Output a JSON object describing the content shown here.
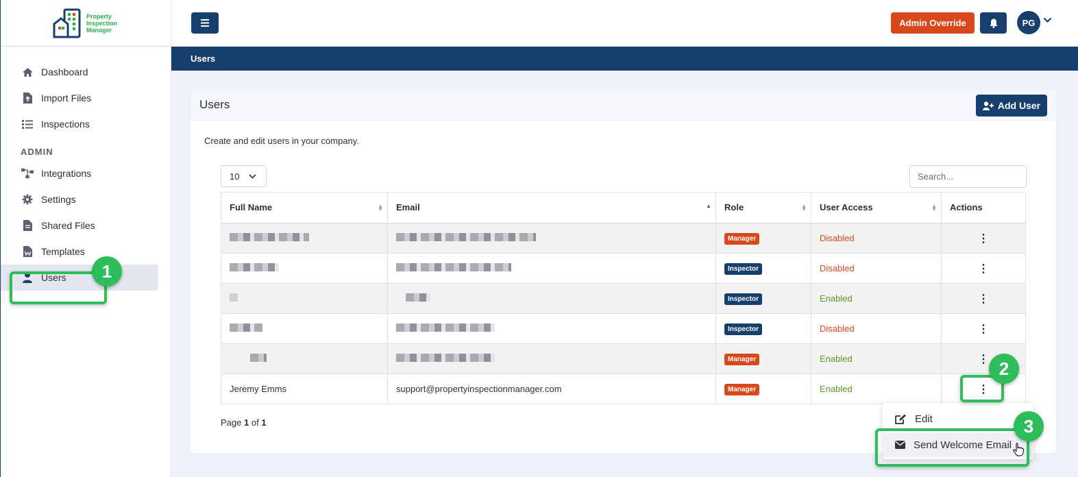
{
  "logo": {
    "line1": "Property",
    "line2": "Inspection",
    "line3": "Manager"
  },
  "sidebar": {
    "items": [
      {
        "label": "Dashboard",
        "icon": "home-icon"
      },
      {
        "label": "Import Files",
        "icon": "file-import-icon"
      },
      {
        "label": "Inspections",
        "icon": "list-icon"
      }
    ],
    "section_label": "ADMIN",
    "admin_items": [
      {
        "label": "Integrations",
        "icon": "sitemap-icon"
      },
      {
        "label": "Settings",
        "icon": "gear-icon"
      },
      {
        "label": "Shared Files",
        "icon": "file-icon"
      },
      {
        "label": "Templates",
        "icon": "word-file-icon"
      },
      {
        "label": "Users",
        "icon": "user-icon",
        "active": true
      }
    ]
  },
  "header": {
    "override_label": "Admin Override",
    "avatar_initials": "PG"
  },
  "page_title": "Users",
  "card": {
    "title": "Users",
    "add_user_label": "Add User",
    "description": "Create and edit users in your company.",
    "page_length": "10",
    "search_placeholder": "Search..."
  },
  "table": {
    "columns": [
      "Full Name",
      "Email",
      "Role",
      "User Access",
      "Actions"
    ],
    "rows": [
      {
        "name": "",
        "email": "",
        "role": "Manager",
        "access": "Disabled"
      },
      {
        "name": "",
        "email": "",
        "role": "Inspector",
        "access": "Disabled"
      },
      {
        "name": "",
        "email": "",
        "role": "Inspector",
        "access": "Enabled"
      },
      {
        "name": "",
        "email": "",
        "role": "Inspector",
        "access": "Disabled"
      },
      {
        "name": "",
        "email": "",
        "role": "Manager",
        "access": "Enabled"
      },
      {
        "name": "Jeremy Emms",
        "email": "support@propertyinspectionmanager.com",
        "role": "Manager",
        "access": "Enabled"
      }
    ]
  },
  "pagination": {
    "prefix": "Page",
    "current": "1",
    "of": "of",
    "total": "1"
  },
  "dropdown": {
    "edit_label": "Edit",
    "welcome_label": "Send Welcome Email"
  },
  "callouts": {
    "one": "1",
    "two": "2",
    "three": "3"
  },
  "colors": {
    "brand": "#173f6e",
    "accent": "#d9481b",
    "callout": "#2dbd5a",
    "enabled": "#5a9a1e"
  }
}
